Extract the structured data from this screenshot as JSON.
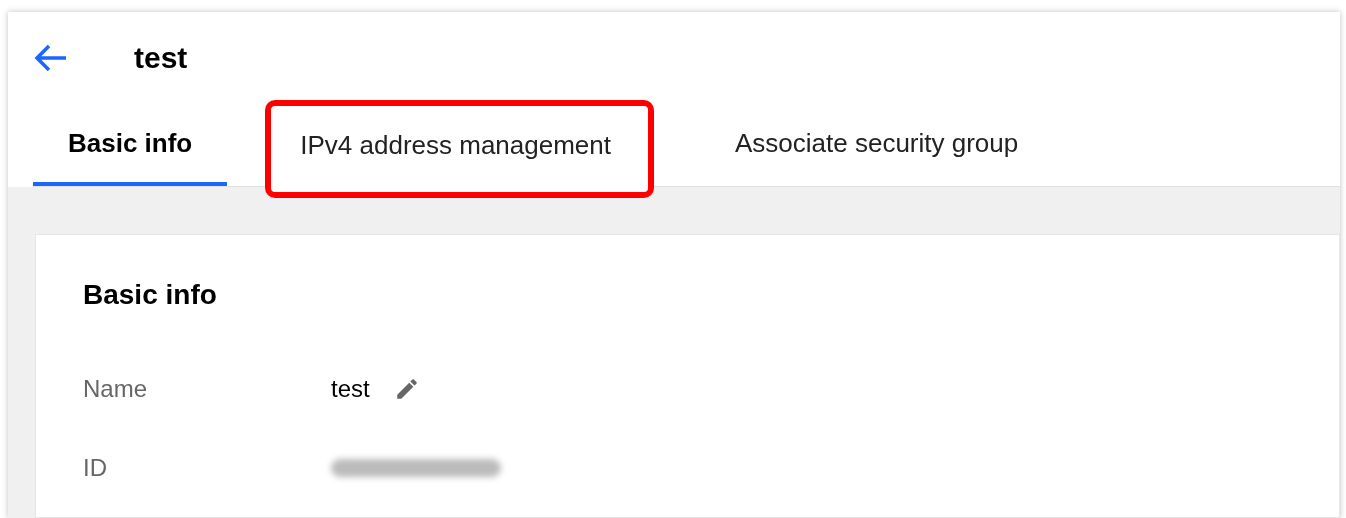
{
  "header": {
    "title": "test"
  },
  "tabs": [
    {
      "label": "Basic info",
      "selected": true,
      "highlighted": false
    },
    {
      "label": "IPv4 address management",
      "selected": false,
      "highlighted": true
    },
    {
      "label": "Associate security group",
      "selected": false,
      "highlighted": false
    }
  ],
  "card": {
    "title": "Basic info",
    "rows": [
      {
        "label": "Name",
        "value": "test",
        "kind": "editable"
      },
      {
        "label": "ID",
        "kind": "redacted"
      }
    ]
  }
}
